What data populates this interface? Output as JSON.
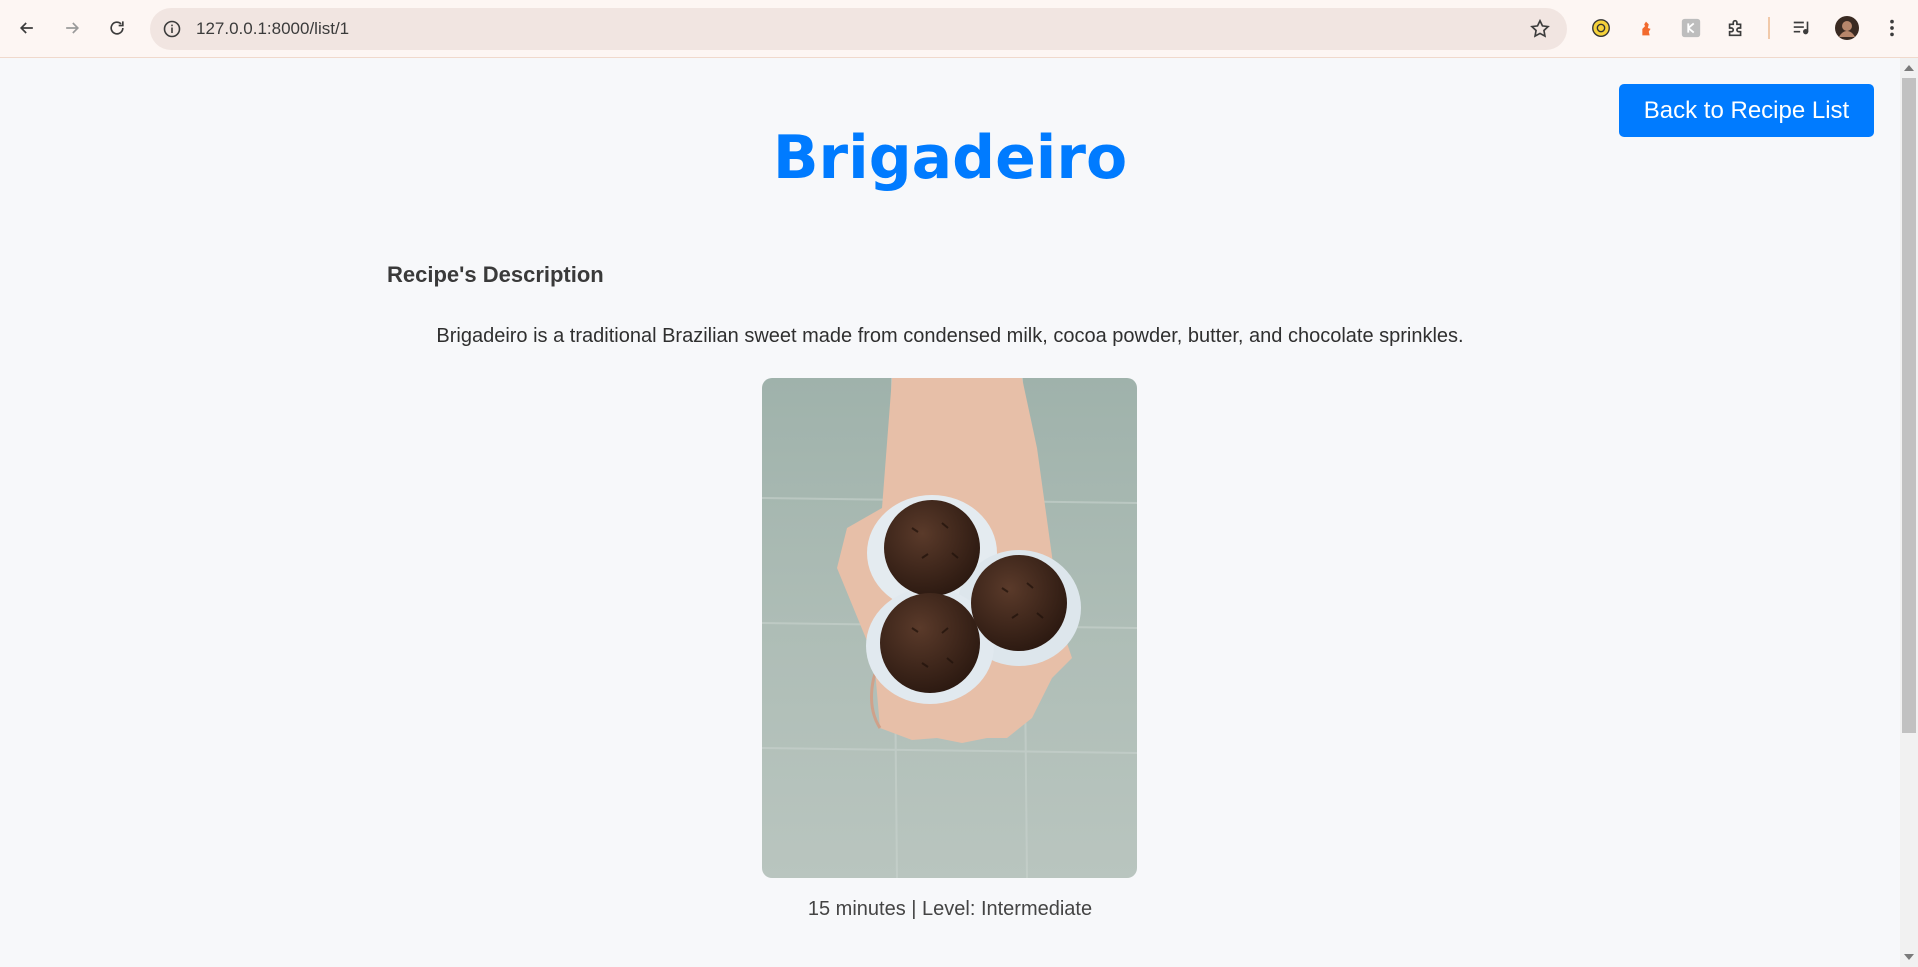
{
  "browser": {
    "url": "127.0.0.1:8000/list/1"
  },
  "page": {
    "back_label": "Back to Recipe List",
    "title": "Brigadeiro",
    "description_heading": "Recipe's Description",
    "description": "Brigadeiro is a traditional Brazilian sweet made from condensed milk, cocoa powder, butter, and chocolate sprinkles.",
    "meta": "15 minutes | Level: Intermediate"
  },
  "colors": {
    "accent": "#007bff",
    "background": "#f7f8fa"
  }
}
